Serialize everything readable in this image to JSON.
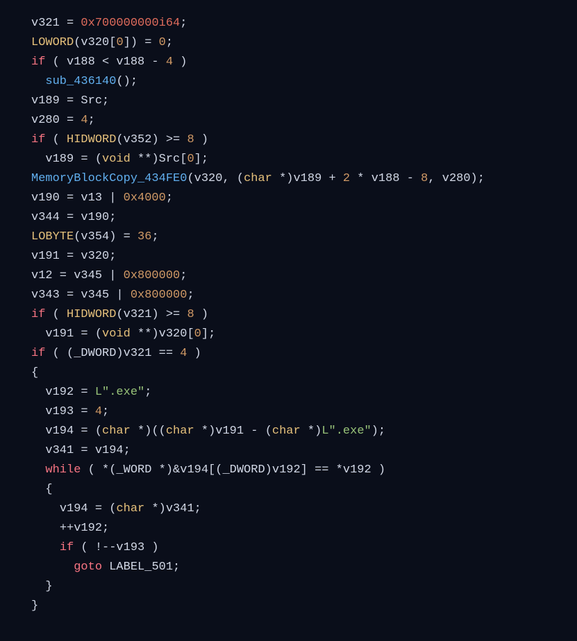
{
  "code": {
    "lines": [
      {
        "indent": 0,
        "tokens": [
          {
            "t": "v321 = ",
            "c": "c-default"
          },
          {
            "t": "0x700000000i64",
            "c": "c-hexred"
          },
          {
            "t": ";",
            "c": "c-default"
          }
        ]
      },
      {
        "indent": 0,
        "tokens": [
          {
            "t": "LOWORD",
            "c": "c-func"
          },
          {
            "t": "(v320[",
            "c": "c-default"
          },
          {
            "t": "0",
            "c": "c-number"
          },
          {
            "t": "]) = ",
            "c": "c-default"
          },
          {
            "t": "0",
            "c": "c-number"
          },
          {
            "t": ";",
            "c": "c-default"
          }
        ]
      },
      {
        "indent": 0,
        "tokens": [
          {
            "t": "if",
            "c": "c-keyword"
          },
          {
            "t": " ( v188 < v188 - ",
            "c": "c-default"
          },
          {
            "t": "4",
            "c": "c-number"
          },
          {
            "t": " )",
            "c": "c-default"
          }
        ]
      },
      {
        "indent": 1,
        "tokens": [
          {
            "t": "sub_436140",
            "c": "c-func2"
          },
          {
            "t": "();",
            "c": "c-default"
          }
        ]
      },
      {
        "indent": 0,
        "tokens": [
          {
            "t": "v189 = Src;",
            "c": "c-default"
          }
        ]
      },
      {
        "indent": 0,
        "tokens": [
          {
            "t": "v280 = ",
            "c": "c-default"
          },
          {
            "t": "4",
            "c": "c-number"
          },
          {
            "t": ";",
            "c": "c-default"
          }
        ]
      },
      {
        "indent": 0,
        "tokens": [
          {
            "t": "if",
            "c": "c-keyword"
          },
          {
            "t": " ( ",
            "c": "c-default"
          },
          {
            "t": "HIDWORD",
            "c": "c-func"
          },
          {
            "t": "(v352) >= ",
            "c": "c-default"
          },
          {
            "t": "8",
            "c": "c-number"
          },
          {
            "t": " )",
            "c": "c-default"
          }
        ]
      },
      {
        "indent": 1,
        "tokens": [
          {
            "t": "v189 = (",
            "c": "c-default"
          },
          {
            "t": "void",
            "c": "c-cast"
          },
          {
            "t": " **)Src[",
            "c": "c-default"
          },
          {
            "t": "0",
            "c": "c-number"
          },
          {
            "t": "];",
            "c": "c-default"
          }
        ]
      },
      {
        "indent": 0,
        "tokens": [
          {
            "t": "MemoryBlockCopy_434FE0",
            "c": "c-func2"
          },
          {
            "t": "(v320, (",
            "c": "c-default"
          },
          {
            "t": "char",
            "c": "c-cast"
          },
          {
            "t": " *)v189 + ",
            "c": "c-default"
          },
          {
            "t": "2",
            "c": "c-number"
          },
          {
            "t": " * v188 - ",
            "c": "c-default"
          },
          {
            "t": "8",
            "c": "c-number"
          },
          {
            "t": ", v280);",
            "c": "c-default"
          }
        ]
      },
      {
        "indent": 0,
        "tokens": [
          {
            "t": "v190 = v13 | ",
            "c": "c-default"
          },
          {
            "t": "0x4000",
            "c": "c-number"
          },
          {
            "t": ";",
            "c": "c-default"
          }
        ]
      },
      {
        "indent": 0,
        "tokens": [
          {
            "t": "v344 = v190;",
            "c": "c-default"
          }
        ]
      },
      {
        "indent": 0,
        "tokens": [
          {
            "t": "LOBYTE",
            "c": "c-func"
          },
          {
            "t": "(v354) = ",
            "c": "c-default"
          },
          {
            "t": "36",
            "c": "c-number"
          },
          {
            "t": ";",
            "c": "c-default"
          }
        ]
      },
      {
        "indent": 0,
        "tokens": [
          {
            "t": "v191 = v320;",
            "c": "c-default"
          }
        ]
      },
      {
        "indent": 0,
        "tokens": [
          {
            "t": "v12 = v345 | ",
            "c": "c-default"
          },
          {
            "t": "0x800000",
            "c": "c-number"
          },
          {
            "t": ";",
            "c": "c-default"
          }
        ]
      },
      {
        "indent": 0,
        "tokens": [
          {
            "t": "v343 = v345 | ",
            "c": "c-default"
          },
          {
            "t": "0x800000",
            "c": "c-number"
          },
          {
            "t": ";",
            "c": "c-default"
          }
        ]
      },
      {
        "indent": 0,
        "tokens": [
          {
            "t": "if",
            "c": "c-keyword"
          },
          {
            "t": " ( ",
            "c": "c-default"
          },
          {
            "t": "HIDWORD",
            "c": "c-func"
          },
          {
            "t": "(v321) >= ",
            "c": "c-default"
          },
          {
            "t": "8",
            "c": "c-number"
          },
          {
            "t": " )",
            "c": "c-default"
          }
        ]
      },
      {
        "indent": 1,
        "tokens": [
          {
            "t": "v191 = (",
            "c": "c-default"
          },
          {
            "t": "void",
            "c": "c-cast"
          },
          {
            "t": " **)v320[",
            "c": "c-default"
          },
          {
            "t": "0",
            "c": "c-number"
          },
          {
            "t": "];",
            "c": "c-default"
          }
        ]
      },
      {
        "indent": 0,
        "tokens": [
          {
            "t": "if",
            "c": "c-keyword"
          },
          {
            "t": " ( (_DWORD)v321 == ",
            "c": "c-default"
          },
          {
            "t": "4",
            "c": "c-number"
          },
          {
            "t": " )",
            "c": "c-default"
          }
        ]
      },
      {
        "indent": 0,
        "tokens": [
          {
            "t": "{",
            "c": "c-default"
          }
        ]
      },
      {
        "indent": 1,
        "tokens": [
          {
            "t": "v192 = ",
            "c": "c-default"
          },
          {
            "t": "L\".exe\"",
            "c": "c-string"
          },
          {
            "t": ";",
            "c": "c-default"
          }
        ]
      },
      {
        "indent": 1,
        "tokens": [
          {
            "t": "v193 = ",
            "c": "c-default"
          },
          {
            "t": "4",
            "c": "c-number"
          },
          {
            "t": ";",
            "c": "c-default"
          }
        ]
      },
      {
        "indent": 1,
        "tokens": [
          {
            "t": "v194 = (",
            "c": "c-default"
          },
          {
            "t": "char",
            "c": "c-cast"
          },
          {
            "t": " *)((",
            "c": "c-default"
          },
          {
            "t": "char",
            "c": "c-cast"
          },
          {
            "t": " *)v191 - (",
            "c": "c-default"
          },
          {
            "t": "char",
            "c": "c-cast"
          },
          {
            "t": " *)",
            "c": "c-default"
          },
          {
            "t": "L\".exe\"",
            "c": "c-string"
          },
          {
            "t": ");",
            "c": "c-default"
          }
        ]
      },
      {
        "indent": 1,
        "tokens": [
          {
            "t": "v341 = v194;",
            "c": "c-default"
          }
        ]
      },
      {
        "indent": 1,
        "tokens": [
          {
            "t": "while",
            "c": "c-keyword"
          },
          {
            "t": " ( *(_WORD *)&v194[(_DWORD)v192] == *v192 )",
            "c": "c-default"
          }
        ]
      },
      {
        "indent": 1,
        "tokens": [
          {
            "t": "{",
            "c": "c-default"
          }
        ]
      },
      {
        "indent": 2,
        "tokens": [
          {
            "t": "v194 = (",
            "c": "c-default"
          },
          {
            "t": "char",
            "c": "c-cast"
          },
          {
            "t": " *)v341;",
            "c": "c-default"
          }
        ]
      },
      {
        "indent": 2,
        "tokens": [
          {
            "t": "++v192;",
            "c": "c-default"
          }
        ]
      },
      {
        "indent": 2,
        "tokens": [
          {
            "t": "if",
            "c": "c-keyword"
          },
          {
            "t": " ( !--v193 )",
            "c": "c-default"
          }
        ]
      },
      {
        "indent": 3,
        "tokens": [
          {
            "t": "goto",
            "c": "c-keyword"
          },
          {
            "t": " LABEL_501;",
            "c": "c-default"
          }
        ]
      },
      {
        "indent": 1,
        "tokens": [
          {
            "t": "}",
            "c": "c-default"
          }
        ]
      },
      {
        "indent": 0,
        "tokens": [
          {
            "t": "}",
            "c": "c-default"
          }
        ]
      }
    ],
    "indent_unit": "  "
  }
}
